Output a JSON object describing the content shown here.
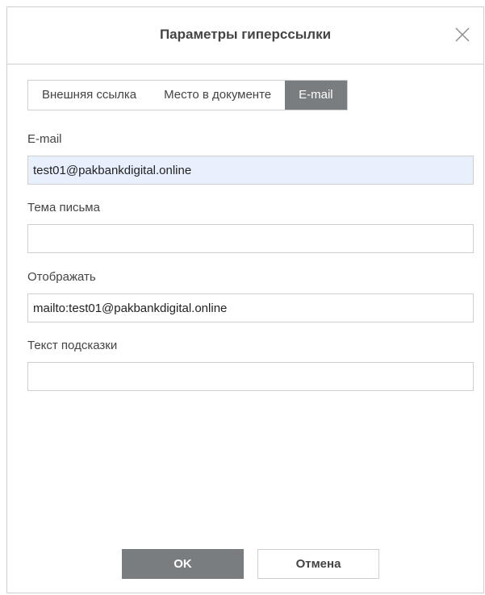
{
  "dialog": {
    "title": "Параметры гиперссылки",
    "close_icon": "close-icon"
  },
  "tabs": [
    {
      "label": "Внешняя ссылка",
      "active": false
    },
    {
      "label": "Место в документе",
      "active": false
    },
    {
      "label": "E-mail",
      "active": true
    }
  ],
  "fields": {
    "email": {
      "label": "E-mail",
      "value": "test01@pakbankdigital.online"
    },
    "subject": {
      "label": "Тема письма",
      "value": ""
    },
    "display": {
      "label": "Отображать",
      "value": "mailto:test01@pakbankdigital.online"
    },
    "tooltip": {
      "label": "Текст подсказки",
      "value": ""
    }
  },
  "buttons": {
    "ok": "OK",
    "cancel": "Отмена"
  },
  "colors": {
    "accent": "#7a7d80",
    "highlight": "#e8f0fe",
    "border": "#cfcfcf"
  }
}
